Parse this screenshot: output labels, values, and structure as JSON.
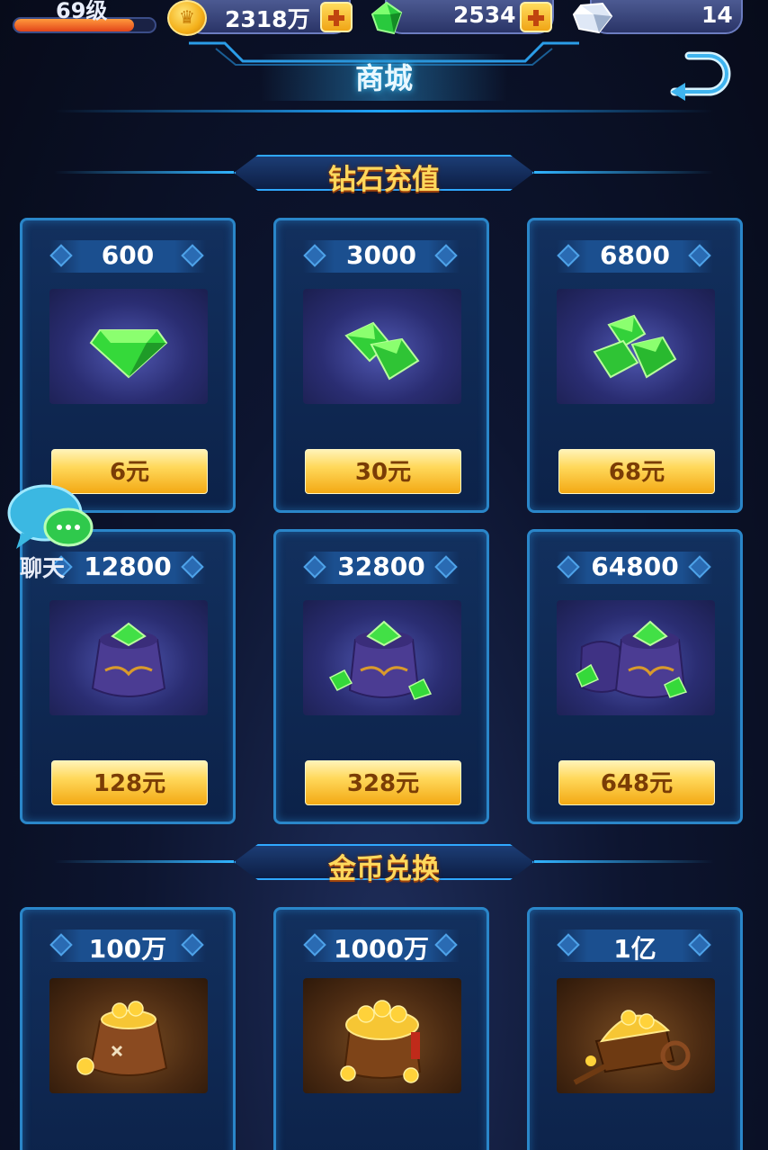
{
  "topbar": {
    "level": "69级",
    "level_progress": 0.85,
    "gold": "2318万",
    "gems": "2534",
    "crystals": "14"
  },
  "title": "商城",
  "sections": {
    "diamond": "钻石充值",
    "gold": "金币兑换"
  },
  "diamond_packs": [
    {
      "amount": "600",
      "price": "6元",
      "icon": "single-gem-icon"
    },
    {
      "amount": "3000",
      "price": "30元",
      "icon": "gem-pile-icon"
    },
    {
      "amount": "6800",
      "price": "68元",
      "icon": "gem-heap-icon"
    },
    {
      "amount": "12800",
      "price": "128元",
      "icon": "gem-bag-icon"
    },
    {
      "amount": "32800",
      "price": "328元",
      "icon": "gem-bag-spill-icon"
    },
    {
      "amount": "64800",
      "price": "648元",
      "icon": "gem-bags-icon"
    }
  ],
  "gold_packs": [
    {
      "amount": "100万",
      "icon": "coin-bag-icon"
    },
    {
      "amount": "1000万",
      "icon": "coin-pot-icon"
    },
    {
      "amount": "1亿",
      "icon": "coin-cart-icon"
    }
  ],
  "chat": {
    "label": "聊天"
  },
  "colors": {
    "accent": "#2fa8ff",
    "button": "#f3a914",
    "section_title": "#ffd85c"
  }
}
